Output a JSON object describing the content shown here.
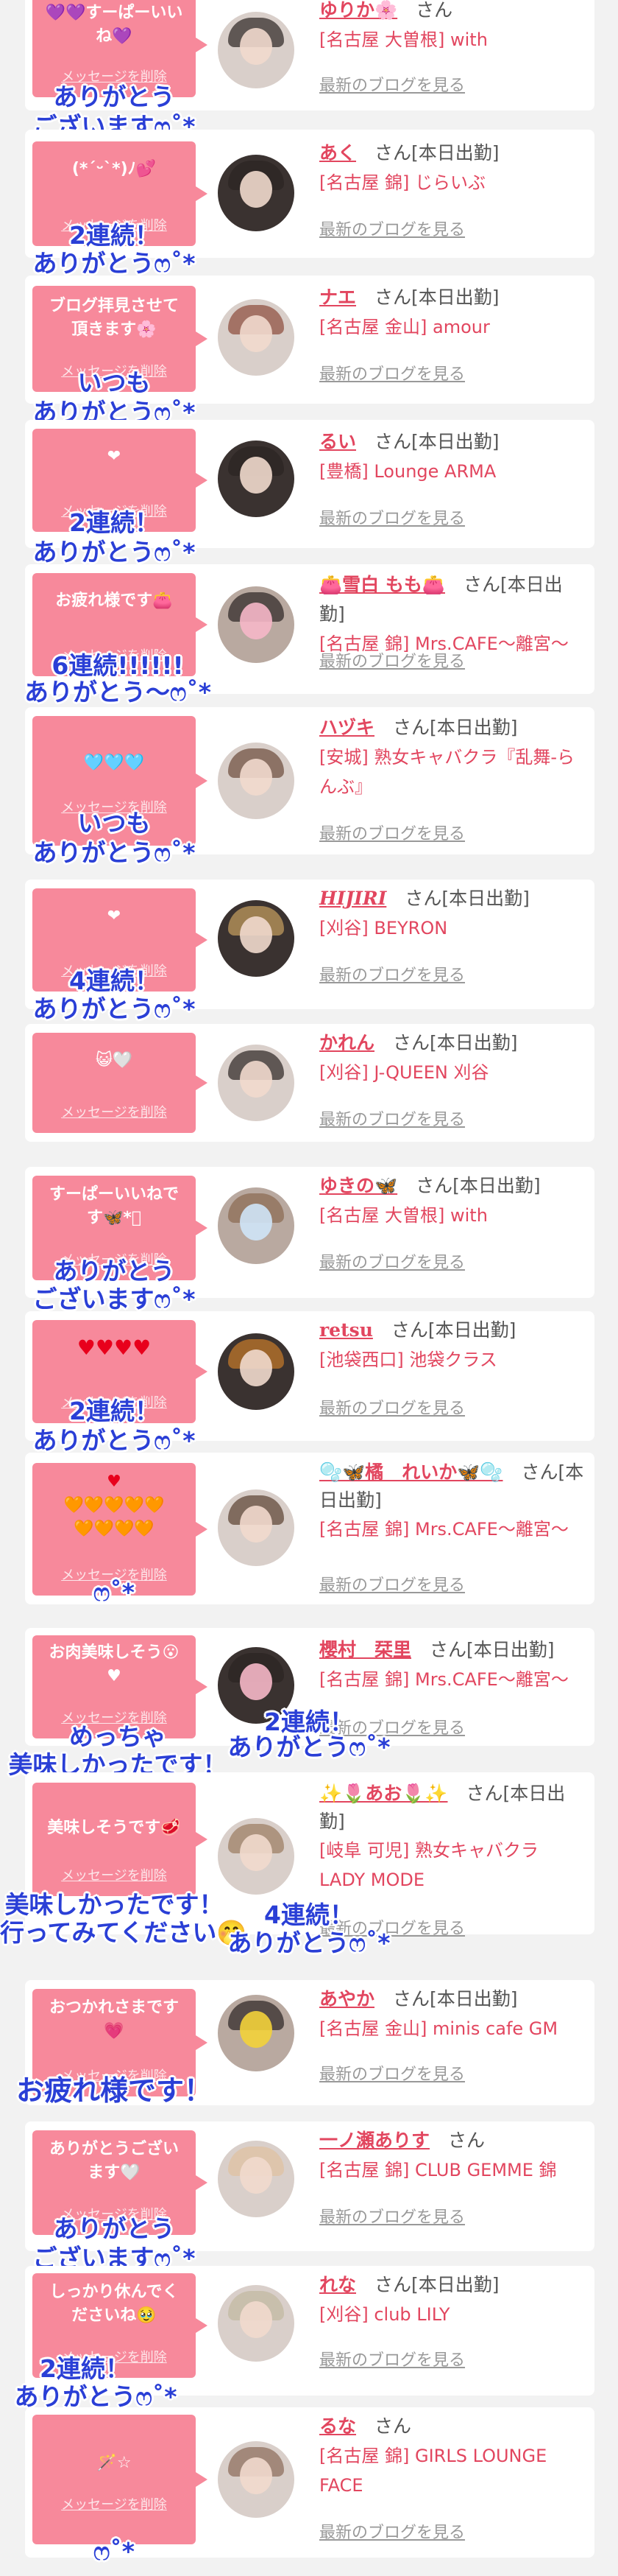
{
  "page": {
    "name_suffix": "さん",
    "shukkin": "さん[本日出勤]",
    "blog_label": "最新のブログを見る",
    "delete_label": "メッセージを削除"
  },
  "entries": [
    {
      "msg": "💜💜すーぱーいい\nね💜",
      "name": "ゆりか🌸",
      "status": "さん",
      "shop": "[名古屋 大曽根] with",
      "cap1": "ありがとう",
      "cap2": "ございますෆ˚*"
    },
    {
      "msg": "(*ˊᵕˋ*)ﾉ💕",
      "name": "あく",
      "status": "さん[本日出勤]",
      "shop": "[名古屋 錦] じらいぶ",
      "cap1": "2連続！",
      "cap2": "ありがとうෆ˚*"
    },
    {
      "msg": "ブログ拝見させて\n頂きます🌸",
      "name": "ナエ",
      "status": "さん[本日出勤]",
      "shop": "[名古屋 金山] amour",
      "cap1": "いつも",
      "cap2": "ありがとうෆ˚*"
    },
    {
      "msg": "❤",
      "name": "るい",
      "status": "さん[本日出勤]",
      "shop": "[豊橋] Lounge ARMA",
      "cap1": "2連続！",
      "cap2": "ありがとうෆ˚*"
    },
    {
      "msg": "お疲れ様です👛",
      "name": "👛雪白 もも👛",
      "status": "さん[本日出勤]",
      "shop": "[名古屋 錦] Mrs.CAFE～離宮～",
      "cap1": "6連続!!!!!!",
      "cap2": "ありがとう～ෆ˚*"
    },
    {
      "msg": "🩵🩵🩵",
      "name": "ハヅキ",
      "status": "さん[本日出勤]",
      "shop": "[安城] 熟女キャバクラ『乱舞-らんぶ』",
      "cap1": "いつも",
      "cap2": "ありがとうෆ˚*"
    },
    {
      "msg": "❤",
      "name": "HIJIRI",
      "status": "さん[本日出勤]",
      "shop": "[刈谷] BEYRON",
      "cap1": "4連続！",
      "cap2": "ありがとうෆ˚*"
    },
    {
      "msg": "😺🤍",
      "name": "かれん",
      "status": "さん[本日出勤]",
      "shop": "[刈谷] J-QUEEN 刈谷",
      "cap1": "",
      "cap2": ""
    },
    {
      "msg": "すーぱーいいねで\nす🦋*ﾟ",
      "name": "ゆきの🦋",
      "status": "さん[本日出勤]",
      "shop": "[名古屋 大曽根] with",
      "cap1": "ありがとう",
      "cap2": "ございますෆ˚*"
    },
    {
      "msg": "♥♥♥♥",
      "name": "retsu",
      "status": "さん[本日出勤]",
      "shop": "[池袋西口] 池袋クラス",
      "cap1": "2連続！",
      "cap2": "ありがとうෆ˚*"
    },
    {
      "msg": "♥\n🧡🧡🧡🧡🧡\n🧡🧡🧡🧡",
      "name": "🫧🦋橘　れいか🦋🫧",
      "status": "さん[本日出勤]",
      "shop": "[名古屋 錦] Mrs.CAFE～離宮～",
      "cap1": "ෆ˚*",
      "cap2": ""
    },
    {
      "msg": "お肉美味しそう😮\n♥",
      "name": "櫻村　栞里",
      "status": "さん[本日出勤]",
      "shop": "[名古屋 錦] Mrs.CAFE～離宮～",
      "cap1": "めっちゃ",
      "cap2": "美味しかったです！",
      "cap3": "2連続！",
      "cap4": "ありがとうෆ˚*"
    },
    {
      "msg": "美味しそうです🥩",
      "name": "✨🌷あお🌷✨",
      "status": "さん[本日出勤]",
      "shop": "[岐阜 可児] 熟女キャバクラ LADY MODE",
      "cap1": "美味しかったです！",
      "cap2": "行ってみてください🤭",
      "cap3": "4連続！",
      "cap4": "ありがとうෆ˚*"
    },
    {
      "msg": "おつかれさまです\n💗",
      "name": "あやか",
      "status": "さん[本日出勤]",
      "shop": "[名古屋 金山] minis cafe GM",
      "cap1": "お疲れ様です！",
      "cap2": ""
    },
    {
      "msg": "ありがとうござい\nます🤍",
      "name": "一ノ瀬ありす",
      "status": "さん",
      "shop": "[名古屋 錦] CLUB GEMME 錦",
      "cap1": "ありがとう",
      "cap2": "ございますෆ˚*"
    },
    {
      "msg": "しっかり休んでく\nださいね🥹",
      "name": "れな",
      "status": "さん[本日出勤]",
      "shop": "[刈谷] club LILY",
      "cap1": "2連続！",
      "cap2": "ありがとうෆ˚*"
    },
    {
      "msg": "🪄☆",
      "name": "るな",
      "status": "さん",
      "shop": "[名古屋 錦] GIRLS LOUNGE FACE",
      "cap1": "ෆ˚*",
      "cap2": ""
    }
  ]
}
